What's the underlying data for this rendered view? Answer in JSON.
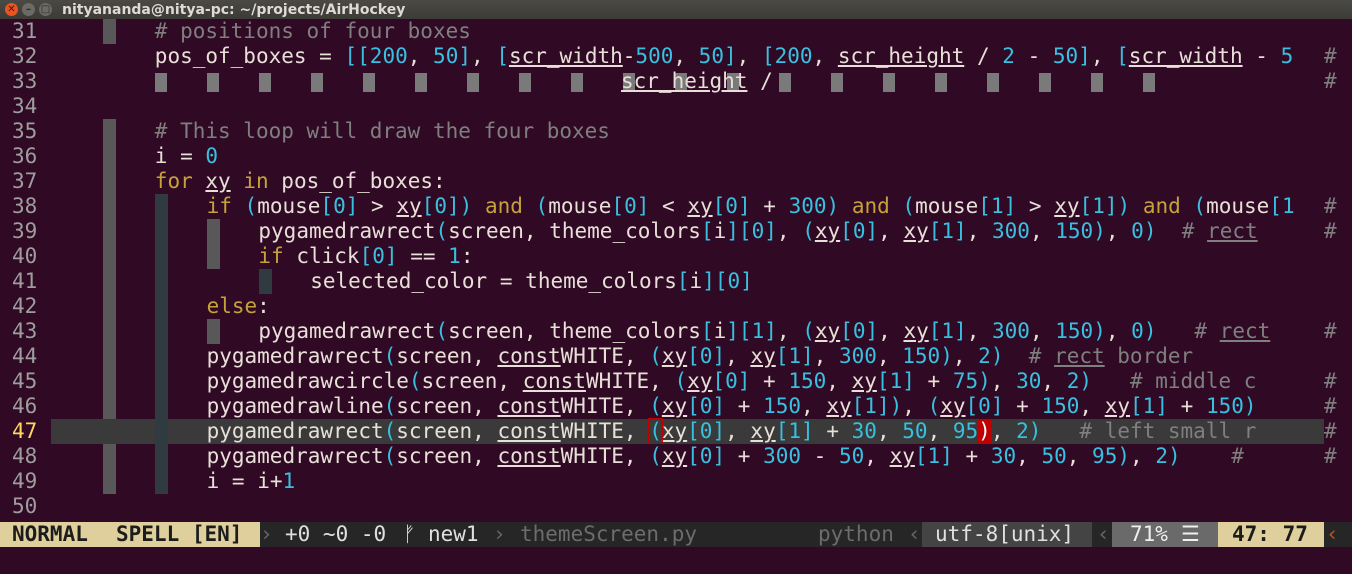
{
  "window": {
    "title": "nityananda@nitya-pc: ~/projects/AirHockey",
    "close_glyph": "✕",
    "min_glyph": "–",
    "max_glyph": "□"
  },
  "editor": {
    "line_numbers": [
      "31",
      "32",
      "33",
      "34",
      "35",
      "36",
      "37",
      "38",
      "39",
      "40",
      "41",
      "42",
      "43",
      "44",
      "45",
      "46",
      "47",
      "48",
      "49",
      "50"
    ],
    "current_line": "47",
    "lines": [
      {
        "t": "# positions of four boxes"
      },
      {
        "t": "pos_of_boxes = [[200, 50], [scr_width-500, 50], [200, scr_height / 2 - 50], [scr_width - 5"
      },
      {
        "t": "scr_height / "
      },
      {
        "t": ""
      },
      {
        "t": "# This loop will draw the four boxes"
      },
      {
        "t": "i = 0"
      },
      {
        "t": "for xy in pos_of_boxes:"
      },
      {
        "t": "if (mouse[0] > xy[0]) and (mouse[0] < xy[0] + 300) and (mouse[1] > xy[1]) and (mouse[1"
      },
      {
        "t": "pygame.draw.rect(screen, theme_colors[i][0], (xy[0], xy[1], 300, 150), 0)  # rect "
      },
      {
        "t": "if click[0] == 1:"
      },
      {
        "t": "selected_color = theme_colors[i][0]"
      },
      {
        "t": "else:"
      },
      {
        "t": "pygame.draw.rect(screen, theme_colors[i][1], (xy[0], xy[1], 300, 150), 0)   # rect"
      },
      {
        "t": "pygame.draw.rect(screen, const.WHITE, (xy[0], xy[1], 300, 150), 2)  # rect border"
      },
      {
        "t": "pygame.draw.circle(screen, const.WHITE, (xy[0] + 150, xy[1] + 75), 30, 2)   # middle c"
      },
      {
        "t": "pygame.draw.line(screen, const.WHITE, (xy[0] + 150, xy[1]), (xy[0] + 150, xy[1] + 150)"
      },
      {
        "t": "pygame.draw.rect(screen, const.WHITE, (xy[0], xy[1] + 30, 50, 95), 2)   # left small r"
      },
      {
        "t": "pygame.draw.rect(screen, const.WHITE, (xy[0] + 300 - 50, xy[1] + 30, 50, 95), 2)    # "
      },
      {
        "t": "i = i+1"
      },
      {
        "t": ""
      }
    ],
    "overflow_marker": "#"
  },
  "statusline": {
    "mode": "NORMAL",
    "spell": "SPELL [EN]",
    "separator": "›",
    "separator_left": "‹",
    "hunks": "+0 ~0 -0",
    "branch_glyph": "ᚠ",
    "branch": "new1",
    "filename": "themeScreen.py",
    "filetype": "python",
    "encoding": "utf-8[unix]",
    "percent": "71%",
    "lines_glyph": "☰",
    "cursor_pos": "47: 77",
    "end_marker": "‹"
  },
  "colors": {
    "background": "#300a24",
    "comment": "#7f7f7f",
    "keyword": "#c6a23a",
    "number": "#39c0e0",
    "mode_bg": "#dfcf9d",
    "match_paren": "#c00000"
  }
}
